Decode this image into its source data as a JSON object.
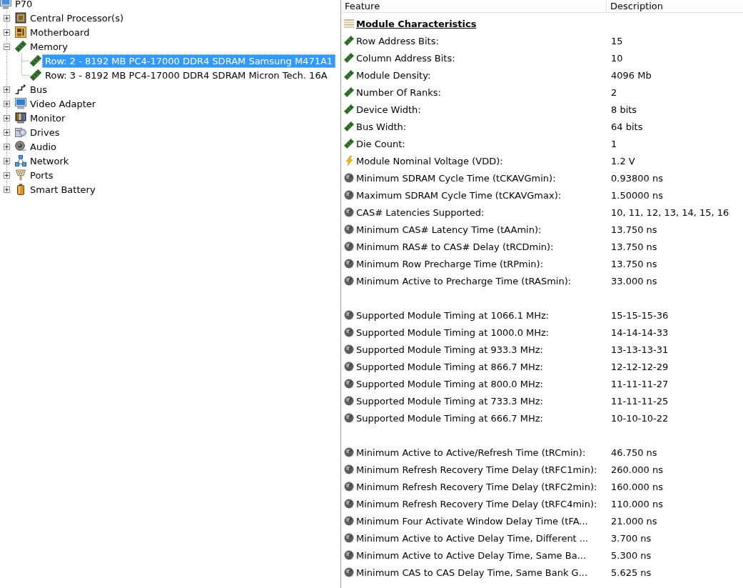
{
  "tree": {
    "label": "P70",
    "kind": "computer",
    "selected": false,
    "children": [
      {
        "label": "Central Processor(s)",
        "kind": "cpu",
        "expanded": false,
        "selected": false
      },
      {
        "label": "Motherboard",
        "kind": "motherboard",
        "expanded": false,
        "selected": false
      },
      {
        "label": "Memory",
        "kind": "memory",
        "expanded": true,
        "selected": false,
        "children": [
          {
            "label": "Row: 2 - 8192 MB PC4-17000 DDR4 SDRAM Samsung M471A1",
            "kind": "module",
            "selected": true
          },
          {
            "label": "Row: 3 - 8192 MB PC4-17000 DDR4 SDRAM Micron Tech. 16A",
            "kind": "module",
            "selected": false
          }
        ]
      },
      {
        "label": "Bus",
        "kind": "bus",
        "expanded": false,
        "selected": false
      },
      {
        "label": "Video Adapter",
        "kind": "display",
        "expanded": false,
        "selected": false
      },
      {
        "label": "Monitor",
        "kind": "monitor",
        "expanded": false,
        "selected": false
      },
      {
        "label": "Drives",
        "kind": "drives",
        "expanded": false,
        "selected": false
      },
      {
        "label": "Audio",
        "kind": "audio",
        "expanded": false,
        "selected": false
      },
      {
        "label": "Network",
        "kind": "network",
        "expanded": false,
        "selected": false
      },
      {
        "label": "Ports",
        "kind": "ports",
        "expanded": false,
        "selected": false
      },
      {
        "label": "Smart Battery",
        "kind": "battery",
        "expanded": false,
        "selected": false
      }
    ]
  },
  "details": {
    "columns": [
      "Feature",
      "Description"
    ],
    "sections": [
      {
        "heading": "Module Characteristics",
        "rows": [
          {
            "kind": "module",
            "feature": "Row Address Bits:",
            "value": "15"
          },
          {
            "kind": "module",
            "feature": "Column Address Bits:",
            "value": "10"
          },
          {
            "kind": "module",
            "feature": "Module Density:",
            "value": "4096 Mb"
          },
          {
            "kind": "module",
            "feature": "Number Of Ranks:",
            "value": "2"
          },
          {
            "kind": "module",
            "feature": "Device Width:",
            "value": "8 bits"
          },
          {
            "kind": "module",
            "feature": "Bus Width:",
            "value": "64 bits"
          },
          {
            "kind": "module",
            "feature": "Die Count:",
            "value": "1"
          },
          {
            "kind": "voltage",
            "feature": "Module Nominal Voltage (VDD):",
            "value": "1.2 V"
          },
          {
            "kind": "timing",
            "feature": "Minimum SDRAM Cycle Time (tCKAVGmin):",
            "value": "0.93800 ns"
          },
          {
            "kind": "timing",
            "feature": "Maximum SDRAM Cycle Time (tCKAVGmax):",
            "value": "1.50000 ns"
          },
          {
            "kind": "timing",
            "feature": "CAS# Latencies Supported:",
            "value": "10, 11, 12, 13, 14, 15, 16"
          },
          {
            "kind": "timing",
            "feature": "Minimum CAS# Latency Time (tAAmin):",
            "value": "13.750 ns"
          },
          {
            "kind": "timing",
            "feature": "Minimum RAS# to CAS# Delay (tRCDmin):",
            "value": "13.750 ns"
          },
          {
            "kind": "timing",
            "feature": "Minimum Row Precharge Time (tRPmin):",
            "value": "13.750 ns"
          },
          {
            "kind": "timing",
            "feature": "Minimum Active to Precharge Time (tRASmin):",
            "value": "33.000 ns"
          }
        ]
      },
      {
        "rows": [
          {
            "kind": "timing",
            "feature": "Supported Module Timing at 1066.1 MHz:",
            "value": "15-15-15-36"
          },
          {
            "kind": "timing",
            "feature": "Supported Module Timing at 1000.0 MHz:",
            "value": "14-14-14-33"
          },
          {
            "kind": "timing",
            "feature": "Supported Module Timing at 933.3 MHz:",
            "value": "13-13-13-31"
          },
          {
            "kind": "timing",
            "feature": "Supported Module Timing at 866.7 MHz:",
            "value": "12-12-12-29"
          },
          {
            "kind": "timing",
            "feature": "Supported Module Timing at 800.0 MHz:",
            "value": "11-11-11-27"
          },
          {
            "kind": "timing",
            "feature": "Supported Module Timing at 733.3 MHz:",
            "value": "11-11-11-25"
          },
          {
            "kind": "timing",
            "feature": "Supported Module Timing at 666.7 MHz:",
            "value": "10-10-10-22"
          }
        ]
      },
      {
        "rows": [
          {
            "kind": "timing",
            "feature": "Minimum Active to Active/Refresh Time (tRCmin):",
            "value": "46.750 ns"
          },
          {
            "kind": "timing",
            "feature": "Minimum Refresh Recovery Time Delay (tRFC1min):",
            "value": "260.000 ns"
          },
          {
            "kind": "timing",
            "feature": "Minimum Refresh Recovery Time Delay (tRFC2min):",
            "value": "160.000 ns"
          },
          {
            "kind": "timing",
            "feature": "Minimum Refresh Recovery Time Delay (tRFC4min):",
            "value": "110.000 ns"
          },
          {
            "kind": "timing",
            "feature": "Minimum Four Activate Window Delay Time (tFA...",
            "value": "21.000 ns"
          },
          {
            "kind": "timing",
            "feature": "Minimum Active to Active Delay Time, Different ...",
            "value": "3.700 ns"
          },
          {
            "kind": "timing",
            "feature": "Minimum Active to Active Delay Time, Same Ba...",
            "value": "5.300 ns"
          },
          {
            "kind": "timing",
            "feature": "Minimum CAS to CAS Delay Time, Same Bank G...",
            "value": "5.625 ns"
          }
        ]
      }
    ]
  }
}
